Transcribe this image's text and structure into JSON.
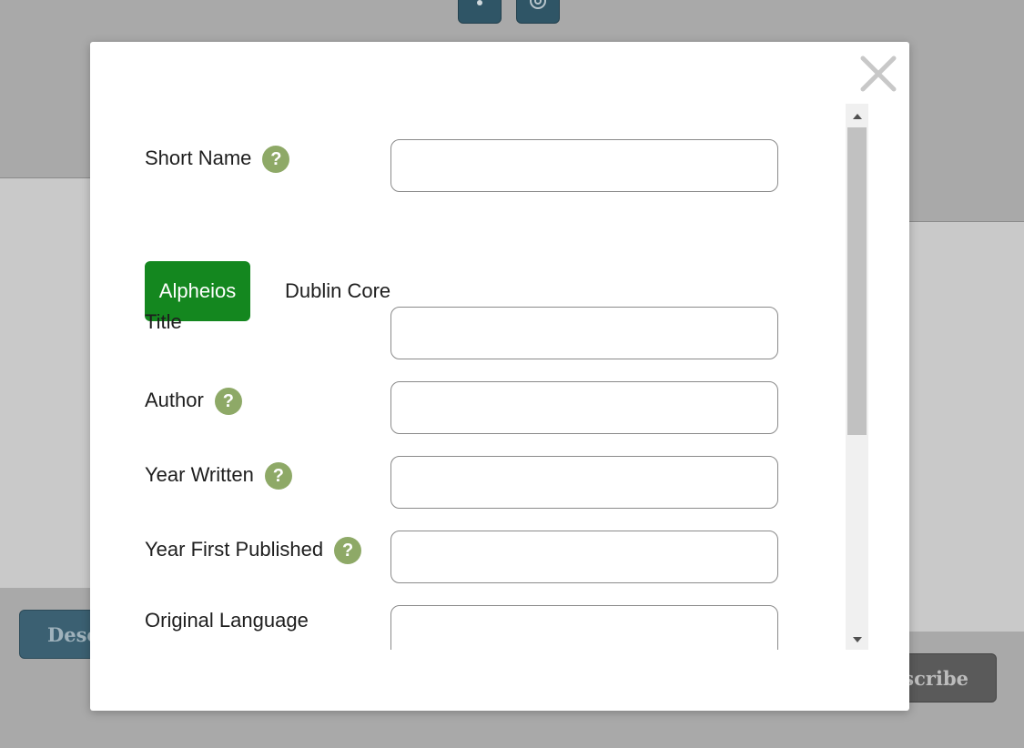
{
  "background": {
    "top_buttons": [
      {
        "icon": "vertical-dots-icon"
      },
      {
        "icon": "gear-icon"
      }
    ],
    "description_button_label": "Desc",
    "transcribe_button_label": "scribe"
  },
  "modal": {
    "close_icon": "close-icon",
    "short_name": {
      "label": "Short Name",
      "value": ""
    },
    "tabs": [
      {
        "label": "Alpheios",
        "active": true
      },
      {
        "label": "Dublin Core",
        "active": false
      }
    ],
    "fields": [
      {
        "label": "Title",
        "help": false,
        "value": ""
      },
      {
        "label": "Author",
        "help": true,
        "value": ""
      },
      {
        "label": "Year Written",
        "help": true,
        "value": ""
      },
      {
        "label": "Year First Published",
        "help": true,
        "value": ""
      },
      {
        "label": "Original Language",
        "help": false,
        "value": ""
      }
    ],
    "help_glyph": "?"
  },
  "colors": {
    "active_tab": "#14871f",
    "help_icon": "#8ea967",
    "overlay": "#a9a9a9"
  }
}
